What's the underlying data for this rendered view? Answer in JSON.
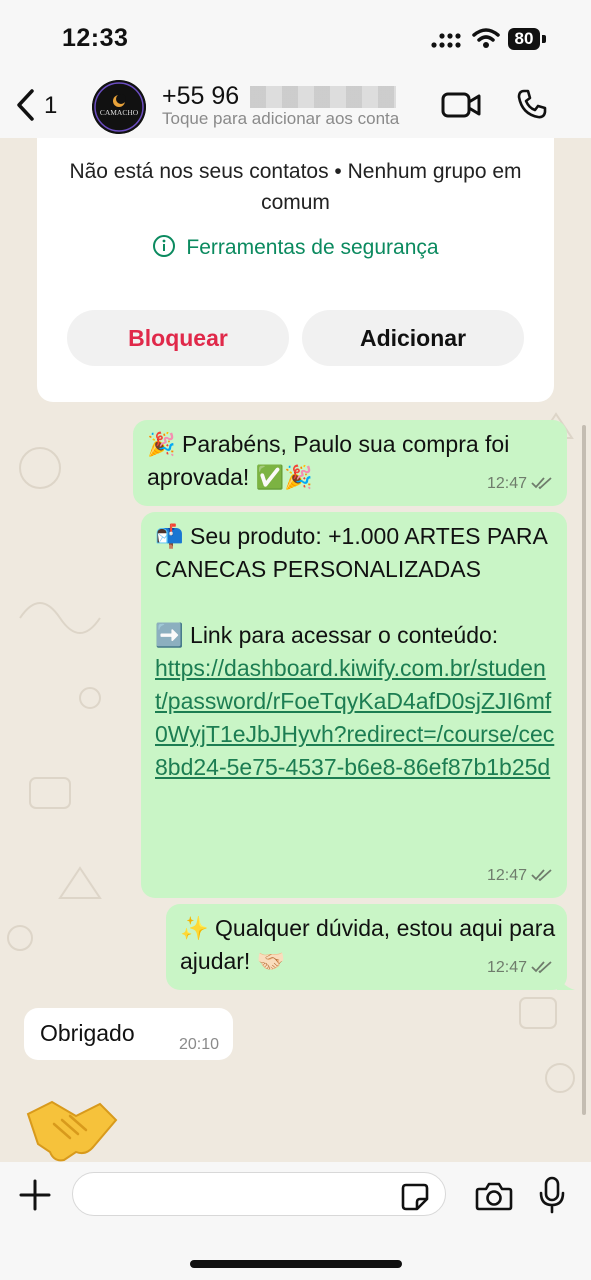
{
  "status_bar": {
    "time": "12:33",
    "battery": "80"
  },
  "header": {
    "back_count": "1",
    "contact_name": "+55 96",
    "subtitle": "Toque para adicionar aos conta",
    "avatar_text": "CAMACHO"
  },
  "info_card": {
    "notice": "Não está nos seus contatos • Nenhum grupo em comum",
    "safety_tools": "Ferramentas de segurança",
    "block_label": "Bloquear",
    "add_label": "Adicionar"
  },
  "messages": [
    {
      "direction": "outgoing",
      "text": "🎉 Parabéns, Paulo sua compra foi aprovada! ✅🎉",
      "time": "12:47"
    },
    {
      "direction": "outgoing",
      "text_intro": "📬 Seu produto: +1.000 ARTES PARA CANECAS PERSONALIZADAS\n\n➡️ Link para acessar o conteúdo:",
      "link": "https://dashboard.kiwify.com.br/student/password/rFoeTqyKaD4afD0sjZJI6mf0WyjT1eJbJHyvh?redirect=/course/cec8bd24-5e75-4537-b6e8-86ef87b1b25d",
      "time": "12:47"
    },
    {
      "direction": "outgoing",
      "text": "✨ Qualquer dúvida, estou aqui para ajudar! 🤝🏻",
      "time": "12:47"
    },
    {
      "direction": "incoming",
      "text": "Obrigado",
      "time": "20:10"
    },
    {
      "direction": "incoming",
      "sticker": "🤝"
    }
  ],
  "composer": {
    "placeholder": "",
    "value": ""
  },
  "icons": {
    "back": "chevron-left-icon",
    "video": "video-call-icon",
    "phone": "phone-icon",
    "info": "info-icon",
    "plus": "plus-icon",
    "sticker": "sticker-icon",
    "camera": "camera-icon",
    "mic": "microphone-icon",
    "read": "double-check-icon"
  },
  "colors": {
    "outgoing_bubble": "#c9f5c6",
    "incoming_bubble": "#ffffff",
    "link": "#1c7d52",
    "block_red": "#e0294a",
    "safety_green": "#0b8a5f"
  }
}
